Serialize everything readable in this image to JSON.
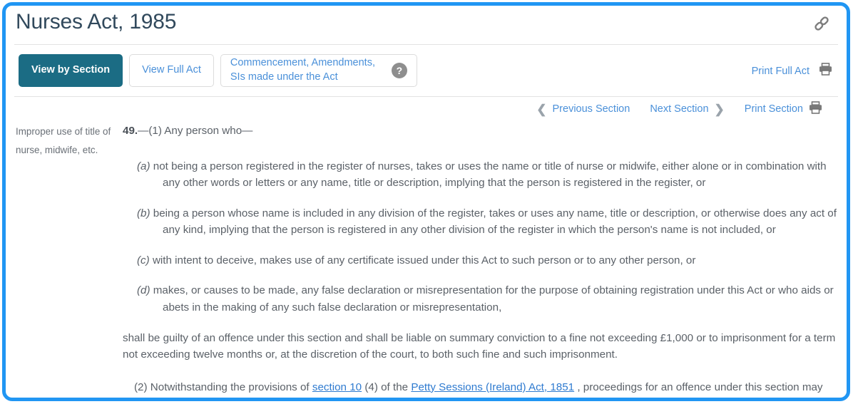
{
  "header": {
    "act_title": "Nurses Act, 1985",
    "link_icon": "chain-link-icon"
  },
  "tabs": [
    {
      "label": "View by Section",
      "active": true
    },
    {
      "label": "View Full Act",
      "active": false
    },
    {
      "label": "Commencement, Amendments, SIs made under the Act",
      "active": false,
      "help_icon": "question-mark-icon"
    }
  ],
  "toolbar": {
    "print_full_act_label": "Print Full Act",
    "print_icon": "printer-icon"
  },
  "section_nav": {
    "previous_label": "Previous Section",
    "next_label": "Next Section",
    "print_section_label": "Print Section",
    "prev_chevron": "chevron-left-icon",
    "next_chevron": "chevron-right-icon",
    "print_icon": "printer-icon"
  },
  "section": {
    "marginal_note": "Improper use of title of nurse, midwife, etc.",
    "number": "49.",
    "lead_in": "—(1) Any person who—",
    "paragraphs": [
      {
        "label": "(a)",
        "text": " not being a person registered in the register of nurses, takes or uses the name or title of nurse or midwife, either alone or in combination with any other words or letters or any name, title or description, implying that the person is registered in the register, or"
      },
      {
        "label": "(b)",
        "text": " being a person whose name is included in any division of the register, takes or uses any name, title or description, or otherwise does any act of any kind, implying that the person is registered in any other division of the register in which the person's name is not included, or"
      },
      {
        "label": "(c)",
        "text": " with intent to deceive, makes use of any certificate issued under this Act to such person or to any other person, or"
      },
      {
        "label": "(d)",
        "text": " makes, or causes to be made, any false declaration or misrepresentation for the purpose of obtaining registration under this Act or who aids or abets in the making of any such false declaration or misrepresentation,"
      }
    ],
    "tail_text": "shall be guilty of an offence under this section and shall be liable on summary conviction to a fine not exceeding £1,000 or to imprisonment for a term not exceeding twelve months or, at the discretion of the court, to both such fine and such imprisonment.",
    "subsection_2": {
      "prefix": "(2) Notwithstanding the provisions of ",
      "link1": "section 10",
      "middle": " (4) of the ",
      "link2": "Petty Sessions (Ireland) Act, 1851",
      "suffix": " , proceedings for an offence under this section may be instituted at any time within two years from the commission of the offence."
    }
  },
  "colors": {
    "frame_blue": "#2196f3",
    "active_tab": "#1b6c84",
    "link_blue": "#4a90d9",
    "body_text": "#5b6168",
    "title_text": "#31495c"
  }
}
